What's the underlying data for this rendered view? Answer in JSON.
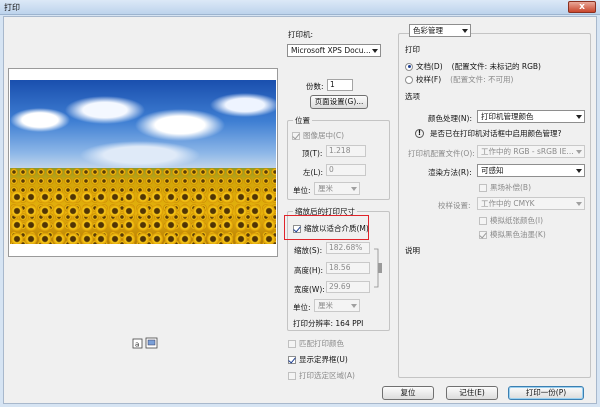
{
  "window": {
    "title": "打印",
    "close": "x"
  },
  "printer": {
    "label": "打印机:",
    "value": "Microsoft XPS Docu..."
  },
  "copies": {
    "label": "份数:",
    "value": "1"
  },
  "page_setup_button": "页面设置(G)...",
  "position": {
    "title": "位置",
    "center_image": "图像居中(C)",
    "top_label": "顶(T):",
    "top_value": "1.218",
    "left_label": "左(L):",
    "left_value": "0",
    "unit_label": "单位:",
    "unit_value": "厘米"
  },
  "scaled_print_size": {
    "title": "缩放后的打印尺寸",
    "scale_to_fit": "缩放以适合介质(M)",
    "scale_label": "缩放(S):",
    "scale_value": "182.68%",
    "height_label": "高度(H):",
    "height_value": "18.56",
    "width_label": "宽度(W):",
    "width_value": "29.69",
    "unit_label": "单位:",
    "unit_value": "厘米",
    "resolution": "打印分辨率: 164 PPI"
  },
  "bottom_options": {
    "match_colors": "匹配打印颜色",
    "show_bbox": "显示定界框(U)",
    "print_selected": "打印选定区域(A)"
  },
  "color_mgmt": {
    "dropdown": "色彩管理",
    "print_heading": "打印",
    "document_radio": "文档(D)",
    "document_profile": "(配置文件: 未标记的 RGB)",
    "proof_radio": "校样(F)",
    "proof_profile": "(配置文件: 不可用)",
    "options_heading": "选项",
    "color_handling_label": "颜色处理(N):",
    "color_handling_value": "打印机管理颜色",
    "notice": "是否已在打印机对话框中启用颜色管理?",
    "printer_profile_label": "打印机配置文件(O):",
    "printer_profile_value": "工作中的 RGB - sRGB IE...",
    "rendering_label": "渲染方法(R):",
    "rendering_value": "可感知",
    "black_point": "黑场补偿(B)",
    "proof_setup_label": "校样设置:",
    "proof_setup_value": "工作中的 CMYK",
    "simulate_paper": "模拟纸张颜色(I)",
    "simulate_black": "模拟黑色油墨(K)",
    "description_heading": "说明"
  },
  "buttons": {
    "done": "复位",
    "remember": "记住(E)",
    "print_one": "打印一份(P)"
  }
}
